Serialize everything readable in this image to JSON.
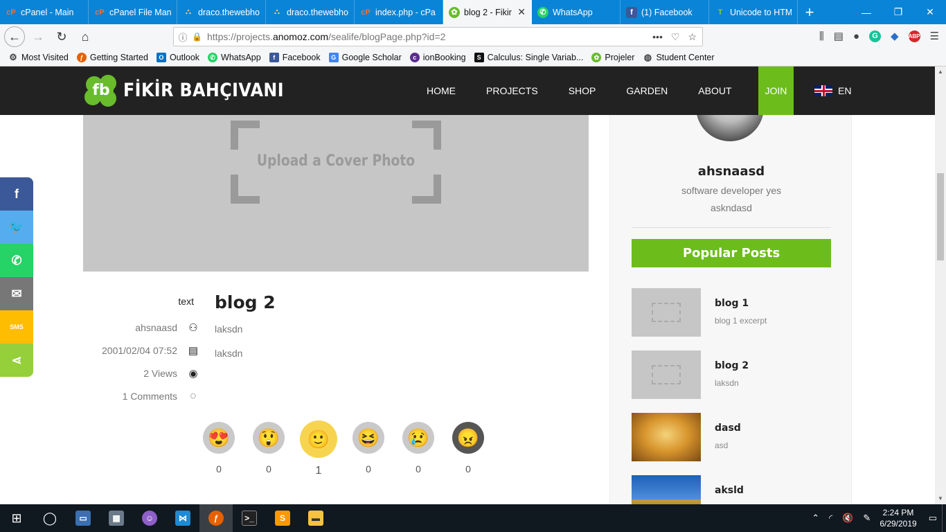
{
  "browser": {
    "tabs": [
      {
        "label": "cPanel - Main",
        "icon": "cpanel-icon",
        "color": "#ff6c2c"
      },
      {
        "label": "cPanel File Mana",
        "icon": "cpanel-icon",
        "color": "#ff6c2c"
      },
      {
        "label": "draco.thewebho",
        "icon": "thewebhost-icon",
        "color": "#e0a800"
      },
      {
        "label": "draco.thewebho",
        "icon": "thewebhost-icon",
        "color": "#e0a800"
      },
      {
        "label": "index.php - cPa",
        "icon": "cpanel-icon",
        "color": "#ff6c2c"
      },
      {
        "label": "blog 2 - Fikir",
        "icon": "fikir-icon",
        "color": "#69bc2c",
        "active": true
      },
      {
        "label": "WhatsApp",
        "icon": "whatsapp-icon",
        "color": "#25d366"
      },
      {
        "label": "(1) Facebook",
        "icon": "facebook-icon",
        "color": "#3b5998"
      },
      {
        "label": "Unicode to HTM",
        "icon": "unicode-icon",
        "color": "#8dc63f"
      }
    ],
    "url": {
      "prefix": "https://projects.",
      "domain": "anomoz.com",
      "path": "/sealife/blogPage.php?id=2"
    },
    "bookmarks": [
      {
        "label": "Most Visited",
        "icon": "gear-icon",
        "color": "#555"
      },
      {
        "label": "Getting Started",
        "icon": "firefox-icon",
        "color": "#e66000"
      },
      {
        "label": "Outlook",
        "icon": "outlook-icon",
        "color": "#0072c6"
      },
      {
        "label": "WhatsApp",
        "icon": "whatsapp-icon",
        "color": "#25d366"
      },
      {
        "label": "Facebook",
        "icon": "facebook-icon",
        "color": "#3b5998"
      },
      {
        "label": "Google Scholar",
        "icon": "scholar-icon",
        "color": "#4285f4"
      },
      {
        "label": "ionBooking",
        "icon": "ionbooking-icon",
        "color": "#5b2d90"
      },
      {
        "label": "Calculus: Single Variab...",
        "icon": "coursera-icon",
        "color": "#111"
      },
      {
        "label": "Projeler",
        "icon": "fikir-icon",
        "color": "#69bc2c"
      },
      {
        "label": "Student Center",
        "icon": "globe-icon",
        "color": "#555"
      }
    ]
  },
  "site": {
    "logo_mark": "fb",
    "logo_text": "FİKİR BAHÇIVANI",
    "nav": [
      "HOME",
      "PROJECTS",
      "SHOP",
      "GARDEN",
      "ABOUT"
    ],
    "join_label": "JOIN",
    "lang_label": "EN",
    "accent": "#6cbd1b",
    "header_bg": "#222222"
  },
  "post": {
    "cover_text": "Upload a Cover Photo",
    "category": "text",
    "author": "ahsnaasd",
    "date": "2001/02/04 07:52",
    "views": "2 Views",
    "comments": "1 Comments",
    "title": "blog 2",
    "paragraph1": "laksdn",
    "paragraph2": "laksdn",
    "reactions": [
      {
        "name": "love",
        "count": "0",
        "glyph": "😍"
      },
      {
        "name": "wow",
        "count": "0",
        "glyph": "😲"
      },
      {
        "name": "smile",
        "count": "1",
        "glyph": "🙂",
        "active": true
      },
      {
        "name": "laugh",
        "count": "0",
        "glyph": "😆"
      },
      {
        "name": "sad",
        "count": "0",
        "glyph": "😢"
      },
      {
        "name": "angry",
        "count": "0",
        "glyph": "😠"
      }
    ]
  },
  "sidebar": {
    "username": "ahsnaasd",
    "bio1": "software developer yes",
    "bio2": "askndasd",
    "popular_title": "Popular Posts",
    "posts": [
      {
        "title": "blog 1",
        "excerpt": "blog 1 excerpt",
        "thumb": "placeholder"
      },
      {
        "title": "blog 2",
        "excerpt": "laksdn",
        "thumb": "placeholder"
      },
      {
        "title": "dasd",
        "excerpt": "asd",
        "thumb": "sunset"
      },
      {
        "title": "aksld",
        "excerpt": "",
        "thumb": "wheat"
      }
    ]
  },
  "share": [
    "facebook",
    "twitter",
    "whatsapp",
    "email",
    "sms",
    "share"
  ],
  "taskbar": {
    "time": "2:24 PM",
    "date": "6/29/2019"
  }
}
